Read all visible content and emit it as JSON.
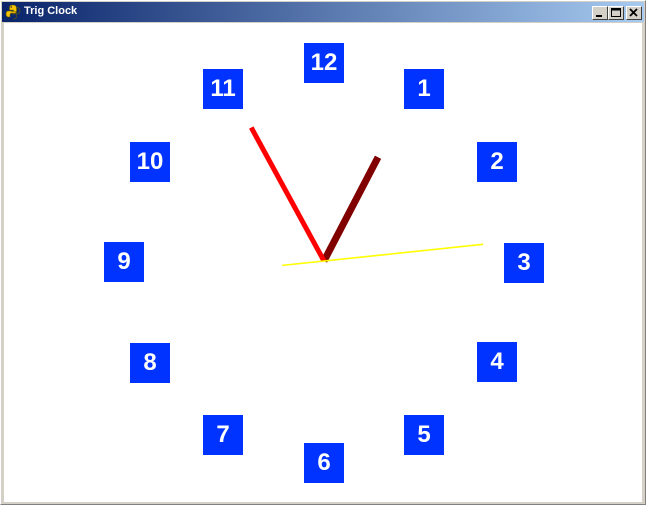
{
  "window": {
    "title": "Trig Clock",
    "app_icon": "python-icon",
    "controls": [
      "minimize-icon",
      "maximize-icon",
      "close-icon"
    ]
  },
  "clock": {
    "numerals": [
      "12",
      "1",
      "2",
      "3",
      "4",
      "5",
      "6",
      "7",
      "8",
      "9",
      "10",
      "11"
    ],
    "face_color": "#ffffff",
    "numeral_bg_color": "#0033ff",
    "numeral_text_color": "#ffffff",
    "hour_hand_color": "#800000",
    "minute_hand_color": "#ff0000",
    "second_hand_color": "#ffff00",
    "time_shown": {
      "hour": 12,
      "minute": 55,
      "second": 14
    }
  }
}
